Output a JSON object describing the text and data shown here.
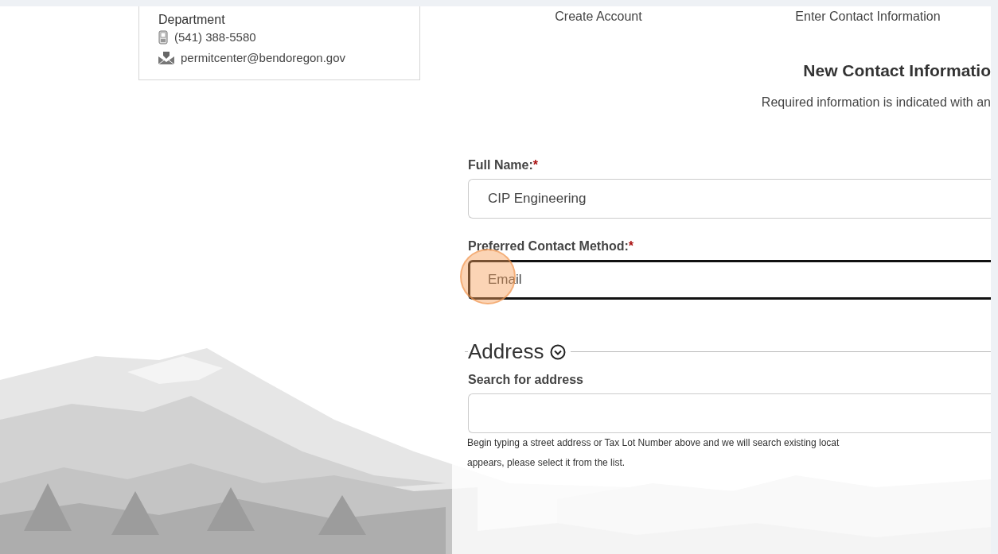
{
  "contact_card": {
    "department": "Department",
    "phone": "(541) 388-5580",
    "email": "permitcenter@bendoregon.gov"
  },
  "steps": [
    {
      "label": "Create Account"
    },
    {
      "label": "Enter Contact Information"
    }
  ],
  "form": {
    "title": "New Contact Informatio",
    "note": "Required information is indicated with an",
    "fields": [
      {
        "label": "Full Name:",
        "required_mark": "*",
        "value": "CIP Engineering",
        "focused": false,
        "highlighted": false
      },
      {
        "label": "Preferred Contact Method:",
        "required_mark": "*",
        "value": "Email",
        "focused": true,
        "highlighted": true
      }
    ],
    "address": {
      "legend": "Address",
      "search_label": "Search for address",
      "help_lines": [
        "Begin typing a street address or Tax Lot Number above and we will search existing locat",
        "appears, please select it from the list."
      ]
    }
  }
}
